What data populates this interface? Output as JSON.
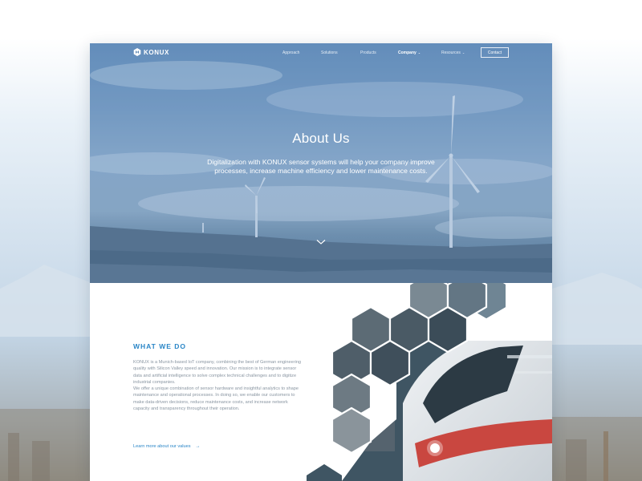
{
  "brand": {
    "name": "KONUX"
  },
  "nav": {
    "items": [
      {
        "label": "Approach"
      },
      {
        "label": "Solutions"
      },
      {
        "label": "Products"
      },
      {
        "label": "Company"
      },
      {
        "label": "Resources"
      }
    ],
    "contact_label": "Contact"
  },
  "hero": {
    "title": "About Us",
    "subtitle": "Digitalization with KONUX sensor systems will help your company improve processes, increase machine efficiency and lower maintenance costs.",
    "scroll_icon": "chevron-down-icon"
  },
  "what_we_do": {
    "heading": "WHAT WE DO",
    "paragraph_1": "KONUX is a Munich-based IoT company, combining the best of German engineering quality with Silicon Valley speed and innovation. Our mission is to integrate sensor data and artificial intelligence to solve complex technical challenges and to digitize industrial companies.",
    "paragraph_2": "We offer a unique combination of sensor hardware and insightful analytics to shape maintenance and operational processes. In doing so, we enable our customers to make data-driven decisions, reduce maintenance costs, and increase network capacity and transparency throughout their operation.",
    "link_label": "Learn more about our values",
    "link_icon": "arrow-right-icon"
  },
  "colors": {
    "accent": "#2a86c7",
    "body_text": "#8a96a2",
    "hero_tint": "#4678af"
  }
}
